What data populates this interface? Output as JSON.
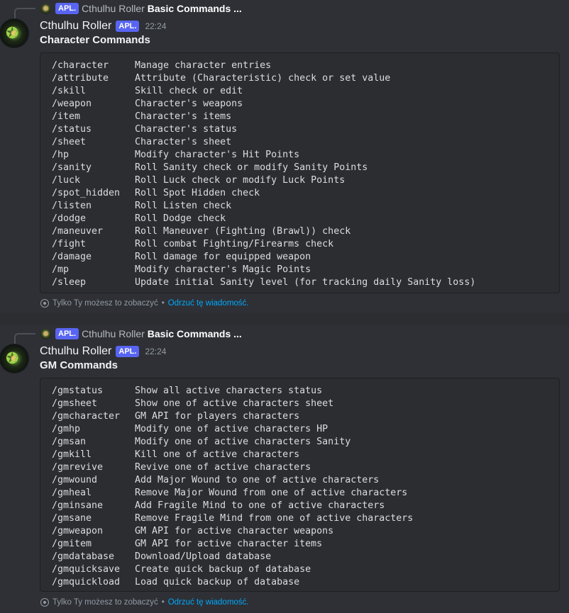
{
  "bot": {
    "name": "Cthulhu Roller",
    "tag": "APL.",
    "time": "22:24"
  },
  "reply": {
    "tag": "APL.",
    "name": "Cthulhu Roller",
    "text": "Basic Commands ..."
  },
  "footer": {
    "notice": "Tylko Ty możesz to zobaczyć",
    "separator": "•",
    "dismiss": "Odrzuć tę wiadomość."
  },
  "messages": [
    {
      "title": "Character Commands",
      "commands": [
        {
          "cmd": "/character",
          "desc": "Manage character entries"
        },
        {
          "cmd": "/attribute",
          "desc": "Attribute (Characteristic) check or set value"
        },
        {
          "cmd": "/skill",
          "desc": "Skill check or edit"
        },
        {
          "cmd": "/weapon",
          "desc": "Character's weapons"
        },
        {
          "cmd": "/item",
          "desc": "Character's items"
        },
        {
          "cmd": "/status",
          "desc": "Character's status"
        },
        {
          "cmd": "/sheet",
          "desc": "Character's sheet"
        },
        {
          "cmd": "/hp",
          "desc": "Modify character's Hit Points"
        },
        {
          "cmd": "/sanity",
          "desc": "Roll Sanity check or modify Sanity Points"
        },
        {
          "cmd": "/luck",
          "desc": "Roll Luck check or modify Luck Points"
        },
        {
          "cmd": "/spot_hidden",
          "desc": "Roll Spot Hidden check"
        },
        {
          "cmd": "/listen",
          "desc": "Roll Listen check"
        },
        {
          "cmd": "/dodge",
          "desc": "Roll Dodge check"
        },
        {
          "cmd": "/maneuver",
          "desc": "Roll Maneuver (Fighting (Brawl)) check"
        },
        {
          "cmd": "/fight",
          "desc": "Roll combat Fighting/Firearms check"
        },
        {
          "cmd": "/damage",
          "desc": "Roll damage for equipped weapon"
        },
        {
          "cmd": "/mp",
          "desc": "Modify character's Magic Points"
        },
        {
          "cmd": "/sleep",
          "desc": "Update initial Sanity level (for tracking daily Sanity loss)"
        }
      ]
    },
    {
      "title": "GM Commands",
      "commands": [
        {
          "cmd": "/gmstatus",
          "desc": "Show all active characters status"
        },
        {
          "cmd": "/gmsheet",
          "desc": "Show one of active characters sheet"
        },
        {
          "cmd": "/gmcharacter",
          "desc": "GM API for players characters"
        },
        {
          "cmd": "/gmhp",
          "desc": "Modify one of active characters HP"
        },
        {
          "cmd": "/gmsan",
          "desc": "Modify one of active characters Sanity"
        },
        {
          "cmd": "/gmkill",
          "desc": "Kill one of active characters"
        },
        {
          "cmd": "/gmrevive",
          "desc": "Revive one of active characters"
        },
        {
          "cmd": "/gmwound",
          "desc": "Add Major Wound to one of active characters"
        },
        {
          "cmd": "/gmheal",
          "desc": "Remove Major Wound from one of active characters"
        },
        {
          "cmd": "/gminsane",
          "desc": "Add Fragile Mind to one of active characters"
        },
        {
          "cmd": "/gmsane",
          "desc": "Remove Fragile Mind from one of active characters"
        },
        {
          "cmd": "/gmweapon",
          "desc": "GM API for active character weapons"
        },
        {
          "cmd": "/gmitem",
          "desc": "GM API for active character items"
        },
        {
          "cmd": "/gmdatabase",
          "desc": "Download/Upload database"
        },
        {
          "cmd": "/gmquicksave",
          "desc": "Create quick backup of database"
        },
        {
          "cmd": "/gmquickload",
          "desc": "Load quick backup of database"
        }
      ]
    }
  ]
}
